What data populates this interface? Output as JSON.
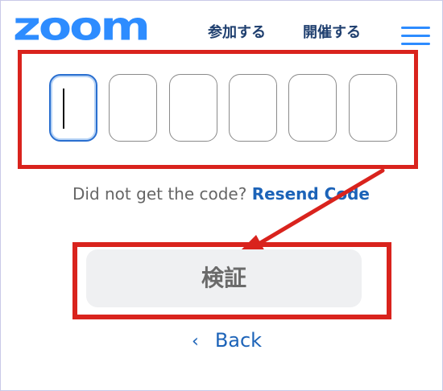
{
  "header": {
    "logo_text": "zoom",
    "nav_join": "参加する",
    "nav_host": "開催する",
    "menu_icon": "hamburger-menu-icon"
  },
  "verification": {
    "code_boxes": [
      "",
      "",
      "",
      "",
      "",
      ""
    ],
    "resend_prompt": "Did not get the code?",
    "resend_link": "Resend Code",
    "verify_label": "検証",
    "back_label": "Back",
    "back_icon": "chevron-left-icon"
  },
  "annotation": {
    "highlight_color": "#d9231d"
  },
  "colors": {
    "brand": "#2d8cff",
    "nav_text": "#1f3f6f",
    "link": "#1c63b8",
    "button_bg": "#eff0f2"
  }
}
